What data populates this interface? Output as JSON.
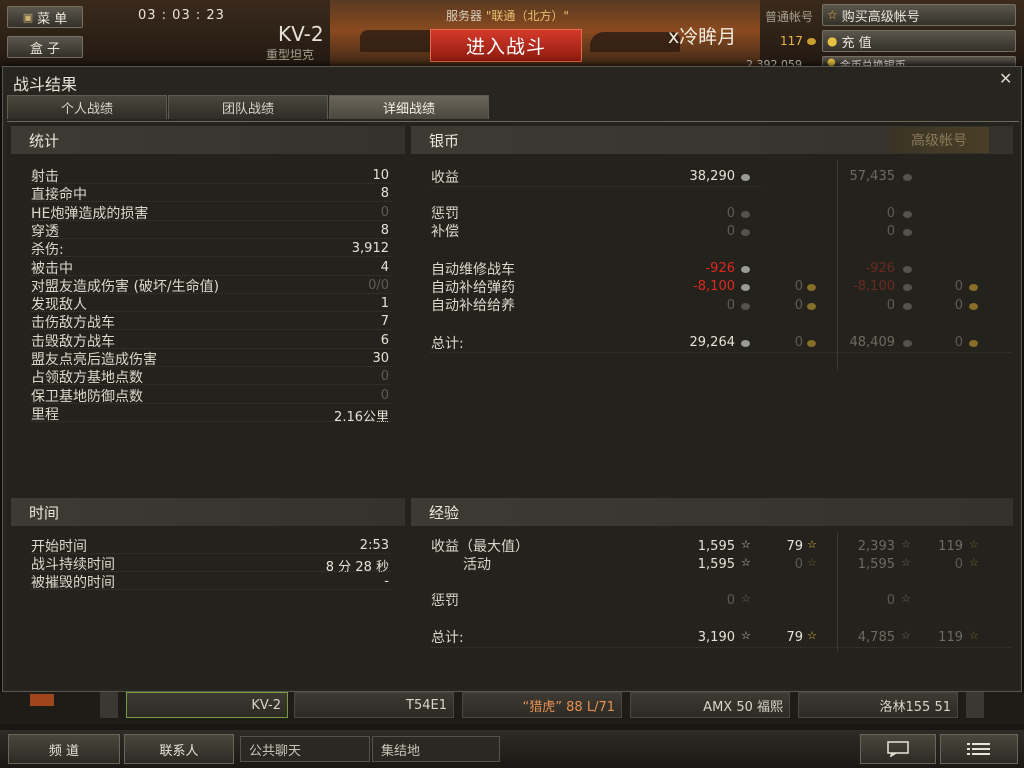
{
  "top": {
    "menu": "菜 单",
    "box": "盒 子",
    "timer": "03 : 03 : 23",
    "tank_name": "KV-2",
    "tank_type": "重型坦克",
    "server_prefix": "服务器",
    "server_name": "\"联通（北方）\"",
    "battle": "进入战斗",
    "player": "x冷眸月",
    "account_type": "普通帐号",
    "gold": "117",
    "silver": "2,392,059",
    "buy_premium": "购买高级帐号",
    "recharge": "充 值",
    "exchange": "金币兑换银币"
  },
  "dialog": {
    "title": "战斗结果",
    "tabs": [
      "个人战绩",
      "团队战绩",
      "详细战绩"
    ],
    "active_tab": 2
  },
  "stats": {
    "header": "统计",
    "rows": [
      {
        "label": "射击",
        "value": "10"
      },
      {
        "label": "直接命中",
        "value": "8"
      },
      {
        "label": "HE炮弹造成的损害",
        "value": "0"
      },
      {
        "label": "穿透",
        "value": "8"
      },
      {
        "label": "杀伤:",
        "value": "3,912"
      },
      {
        "label": "被击中",
        "value": "4"
      },
      {
        "label": "对盟友造成伤害 (破坏/生命值)",
        "value": "0/0"
      },
      {
        "label": "发现敌人",
        "value": "1"
      },
      {
        "label": "击伤敌方战车",
        "value": "7"
      },
      {
        "label": "击毁敌方战车",
        "value": "6"
      },
      {
        "label": "盟友点亮后造成伤害",
        "value": "30"
      },
      {
        "label": "占领敌方基地点数",
        "value": "0"
      },
      {
        "label": "保卫基地防御点数",
        "value": "0"
      },
      {
        "label": "里程",
        "value": "2.16公里"
      }
    ]
  },
  "credits": {
    "header": "银币",
    "premium_header": "高级帐号",
    "income_label": "收益",
    "income": "38,290",
    "income_prem": "57,435",
    "penalty_label": "惩罚",
    "penalty": "0",
    "penalty_prem": "0",
    "comp_label": "补偿",
    "comp": "0",
    "comp_prem": "0",
    "repair_label": "自动维修战车",
    "repair": "-926",
    "repair_prem": "-926",
    "ammo_label": "自动补给弹药",
    "ammo": "-8,100",
    "ammo_gold": "0",
    "ammo_prem": "-8,100",
    "ammo_prem_gold": "0",
    "cons_label": "自动补给给养",
    "cons": "0",
    "cons_gold": "0",
    "cons_prem": "0",
    "cons_prem_gold": "0",
    "total_label": "总计:",
    "total": "29,264",
    "total_gold": "0",
    "total_prem": "48,409",
    "total_prem_gold": "0"
  },
  "time": {
    "header": "时间",
    "start_label": "开始时间",
    "start": "2:53",
    "duration_label": "战斗持续时间",
    "duration": "8 分 28 秒",
    "destroyed_label": "被摧毁的时间",
    "destroyed": "-"
  },
  "xp": {
    "header": "经验",
    "income_label": "收益（最大值）",
    "income": "1,595",
    "income_free": "79",
    "income_prem": "2,393",
    "income_prem_free": "119",
    "activity_label": "活动",
    "activity": "1,595",
    "activity_free": "0",
    "activity_prem": "1,595",
    "activity_prem_free": "0",
    "penalty_label": "惩罚",
    "penalty": "0",
    "penalty_prem": "0",
    "total_label": "总计:",
    "total": "3,190",
    "total_free": "79",
    "total_prem": "4,785",
    "total_prem_free": "119"
  },
  "carousel": [
    "KV-2",
    "T54E1",
    "“猎虎” 88 L/71",
    "AMX 50 福熙",
    "洛林155 51"
  ],
  "bottom": {
    "channels": "频 道",
    "contacts": "联系人",
    "public_chat": "公共聊天",
    "rally": "集结地"
  },
  "colors": {
    "battle_button": "#c8301f",
    "negative": "#e0281e",
    "gold": "#e8b840"
  }
}
